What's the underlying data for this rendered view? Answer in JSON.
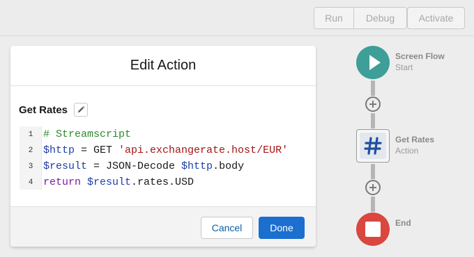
{
  "toolbar": {
    "run_label": "Run",
    "debug_label": "Debug",
    "activate_label": "Activate"
  },
  "modal": {
    "title": "Edit Action",
    "section_title": "Get Rates",
    "code_lines": [
      {
        "num": "1",
        "tokens": [
          {
            "t": "# Streamscript",
            "k": "comment"
          }
        ]
      },
      {
        "num": "2",
        "tokens": [
          {
            "t": "$http",
            "k": "var"
          },
          {
            "t": " = GET ",
            "k": "plain"
          },
          {
            "t": "'api.exchangerate.host/EUR'",
            "k": "str"
          }
        ]
      },
      {
        "num": "3",
        "tokens": [
          {
            "t": "$result",
            "k": "var"
          },
          {
            "t": " = JSON-Decode ",
            "k": "plain"
          },
          {
            "t": "$http",
            "k": "var"
          },
          {
            "t": ".body",
            "k": "plain"
          }
        ]
      },
      {
        "num": "4",
        "tokens": [
          {
            "t": "return",
            "k": "kw"
          },
          {
            "t": " ",
            "k": "plain"
          },
          {
            "t": "$result",
            "k": "var"
          },
          {
            "t": ".rates.USD",
            "k": "plain"
          }
        ]
      }
    ],
    "cancel_label": "Cancel",
    "done_label": "Done"
  },
  "flow": {
    "start": {
      "title": "Screen Flow",
      "subtitle": "Start",
      "icon": "play-icon"
    },
    "action": {
      "title": "Get Rates",
      "subtitle": "Action",
      "icon": "hash-icon"
    },
    "end": {
      "title": "End",
      "icon": "stop-icon"
    }
  },
  "colors": {
    "start_node": "#3e9e98",
    "end_node": "#d9473e",
    "primary_button": "#1b6fcf",
    "hash_icon": "#1f4fa0"
  }
}
